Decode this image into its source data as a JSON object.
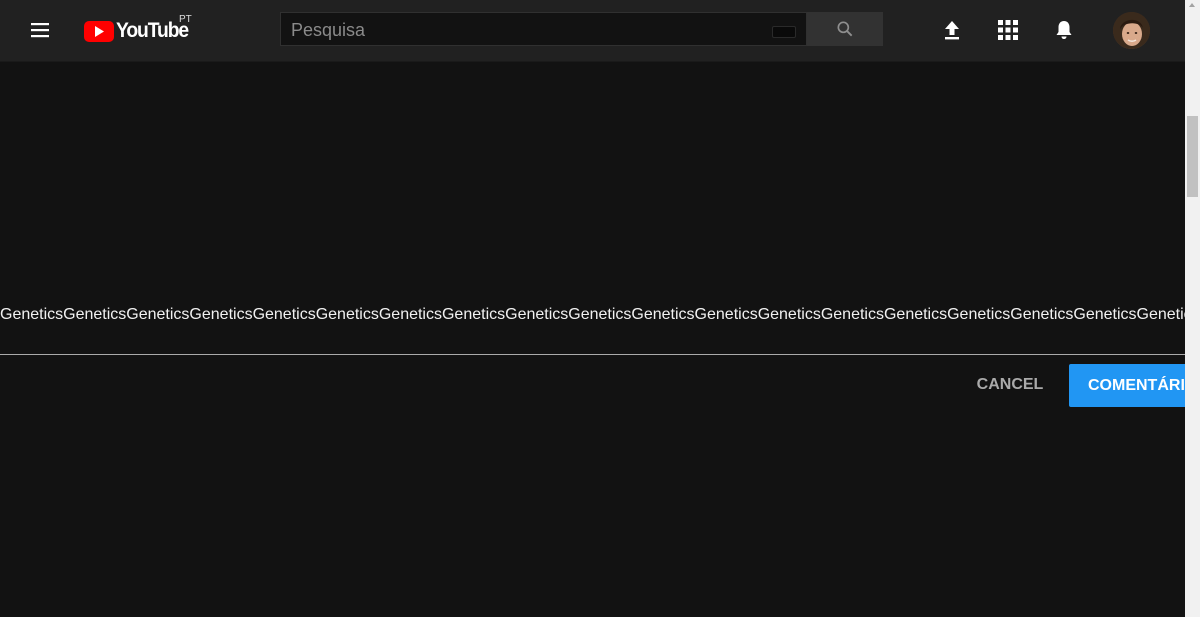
{
  "header": {
    "logo_text": "YouTube",
    "country_code": "PT",
    "search_placeholder": "Pesquisa",
    "search_value": ""
  },
  "icons": {
    "menu": "menu-icon",
    "search": "search-icon",
    "upload": "upload-icon",
    "apps": "apps-grid-icon",
    "notifications": "bell-icon",
    "keyboard": "keyboard-icon"
  },
  "comment": {
    "text": "GeneticsGeneticsGeneticsGeneticsGeneticsGeneticsGeneticsGeneticsGeneticsGeneticsGeneticsGeneticsGeneticsGeneticsGeneticsGeneticsGeneticsGeneticsGenetics",
    "cancel_label": "CANCEL",
    "submit_label": "COMENTÁRIO"
  },
  "colors": {
    "background": "#121212",
    "topbar": "#212121",
    "accent": "#2196f3",
    "brand_red": "#ff0000"
  }
}
